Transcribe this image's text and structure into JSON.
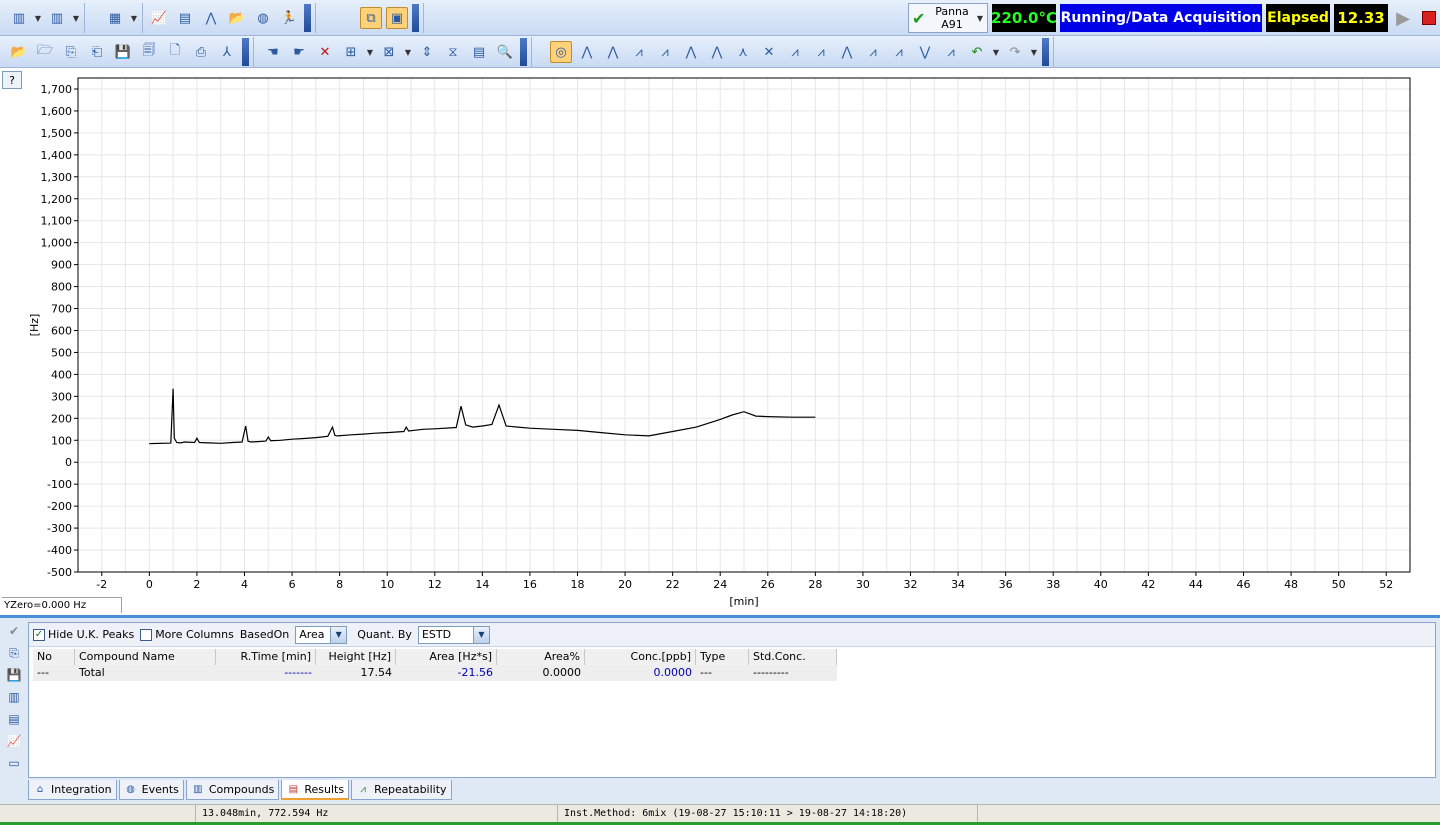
{
  "toolbar1": {
    "instrument": {
      "line1": "Panna",
      "line2": "A91"
    },
    "temperature": "220.0°C",
    "run_status": "Running/Data Acquisition",
    "elapsed_label": "Elapsed",
    "elapsed_value": "12.33"
  },
  "chart_data": {
    "type": "line",
    "title": "",
    "xlabel": "[min]",
    "ylabel": "[Hz]",
    "xlim": [
      -3,
      53
    ],
    "ylim": [
      -500,
      1750
    ],
    "grid": true,
    "x_ticks": [
      -2,
      0,
      2,
      4,
      6,
      8,
      10,
      12,
      14,
      16,
      18,
      20,
      22,
      24,
      26,
      28,
      30,
      32,
      34,
      36,
      38,
      40,
      42,
      44,
      46,
      48,
      50,
      52
    ],
    "y_ticks": [
      -500,
      -400,
      -300,
      -200,
      -100,
      0,
      100,
      200,
      300,
      400,
      500,
      600,
      700,
      800,
      900,
      1000,
      1100,
      1200,
      1300,
      1400,
      1500,
      1600,
      1700
    ],
    "y_tick_labels": [
      "-500",
      "-400",
      "-300",
      "-200",
      "-100",
      "0",
      "100",
      "200",
      "300",
      "400",
      "500",
      "600",
      "700",
      "800",
      "900",
      "1,000",
      "1,100",
      "1,200",
      "1,300",
      "1,400",
      "1,500",
      "1,600",
      "1,700"
    ],
    "series": [
      {
        "color": "#000000",
        "x": [
          0.0,
          0.9,
          1.0,
          1.05,
          1.15,
          1.3,
          1.5,
          1.9,
          2.0,
          2.1,
          2.5,
          3.0,
          3.5,
          3.9,
          4.05,
          4.15,
          4.3,
          4.9,
          5.0,
          5.1,
          5.5,
          6.0,
          6.5,
          7.0,
          7.5,
          7.7,
          7.8,
          7.9,
          8.5,
          9.0,
          9.5,
          10.0,
          10.7,
          10.8,
          10.9,
          11.5,
          12.0,
          12.9,
          13.1,
          13.3,
          13.6,
          14.0,
          14.4,
          14.7,
          15.0,
          15.5,
          16.0,
          17.0,
          18.0,
          19.0,
          20.0,
          21.0,
          22.0,
          23.0,
          24.0,
          24.5,
          25.0,
          25.5,
          26.0,
          27.0,
          28.0
        ],
        "y": [
          85,
          87,
          335,
          110,
          90,
          88,
          92,
          90,
          110,
          90,
          88,
          86,
          90,
          92,
          165,
          95,
          92,
          96,
          115,
          98,
          100,
          105,
          108,
          112,
          118,
          160,
          122,
          120,
          125,
          128,
          132,
          135,
          140,
          160,
          142,
          150,
          152,
          158,
          255,
          170,
          160,
          165,
          172,
          260,
          165,
          160,
          155,
          150,
          145,
          135,
          125,
          120,
          140,
          160,
          195,
          215,
          230,
          210,
          208,
          205,
          205
        ]
      }
    ]
  },
  "yzero": "YZero=0.000 Hz",
  "results": {
    "hide_uk_peaks_label": "Hide U.K. Peaks",
    "hide_uk_peaks_checked": "✓",
    "more_columns_label": "More Columns",
    "based_on_label": "BasedOn",
    "based_on_value": "Area",
    "quant_by_label": "Quant. By",
    "quant_by_value": "ESTD",
    "headers": [
      "No",
      "Compound Name",
      "R.Time [min]",
      "Height [Hz]",
      "Area [Hz*s]",
      "Area%",
      "Conc.[ppb]",
      "Type",
      "Std.Conc."
    ],
    "row": [
      "---",
      "Total",
      "-------",
      "17.54",
      "-21.56",
      "0.0000",
      "0.0000",
      "---",
      "---------"
    ]
  },
  "tabs": [
    "Integration",
    "Events",
    "Compounds",
    "Results",
    "Repeatability"
  ],
  "statusbar": {
    "cursor": "13.048min, 772.594 Hz",
    "method": "Inst.Method: 6mix (19-08-27 15:10:11 > 19-08-27 14:18:20)"
  },
  "help_label": "?"
}
